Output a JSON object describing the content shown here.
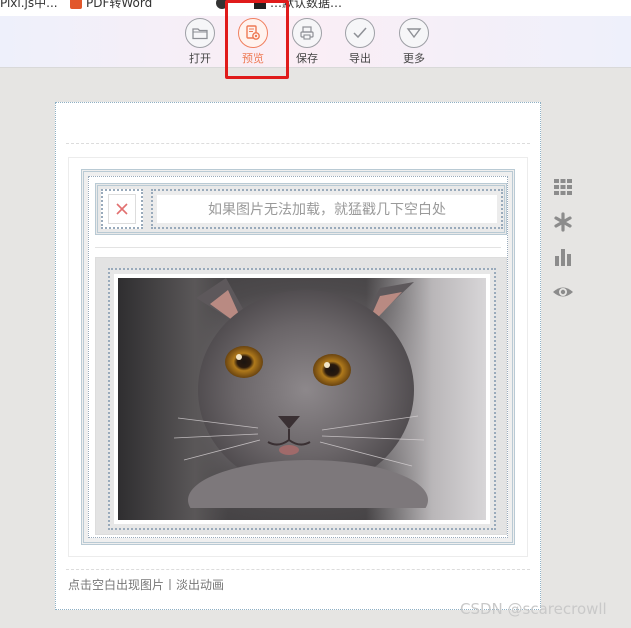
{
  "bookmarks": [
    {
      "label": "Pixi.js中..."
    },
    {
      "label": "PDF转Word"
    },
    {
      "label": "…默认数据…"
    }
  ],
  "toolbar": {
    "items": [
      {
        "label": "打开",
        "icon": "folder-icon"
      },
      {
        "label": "预览",
        "icon": "preview-icon",
        "active": true
      },
      {
        "label": "保存",
        "icon": "printer-icon"
      },
      {
        "label": "导出",
        "icon": "check-icon"
      },
      {
        "label": "更多",
        "icon": "triangle-down-icon"
      }
    ]
  },
  "editor": {
    "placeholder_text": "如果图片无法加载，就猛戳几下空白处",
    "footer_text": "点击空白出现图片丨淡出动画"
  },
  "side_tools": [
    {
      "icon": "grid-icon"
    },
    {
      "icon": "asterisk-icon"
    },
    {
      "icon": "bar-chart-icon"
    },
    {
      "icon": "eye-icon"
    }
  ],
  "watermark": "CSDN @scarecrowll",
  "colors": {
    "accent": "#ee7a55",
    "highlight_box": "#e01b1b",
    "frame_border": "#b9cad4",
    "icon_gray": "#8c8c8c"
  }
}
